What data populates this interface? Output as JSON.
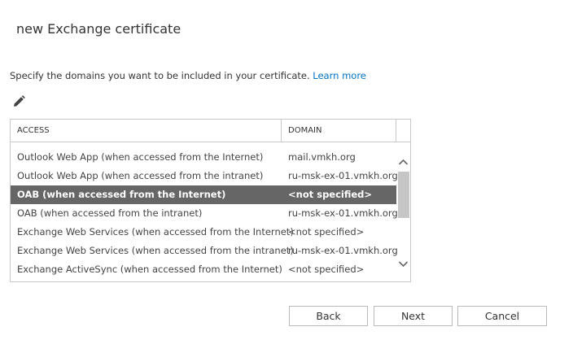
{
  "dialog": {
    "title": "new Exchange certificate",
    "instruction": "Specify the domains you want to be included in your certificate.",
    "learn_more": "Learn more"
  },
  "toolbar": {
    "edit_icon": "pencil-icon"
  },
  "grid": {
    "columns": {
      "access": "ACCESS",
      "domain": "DOMAIN"
    },
    "rows": [
      {
        "access": "Outlook Web App (when accessed from the Internet)",
        "domain": "mail.vmkh.org"
      },
      {
        "access": "Outlook Web App (when accessed from the intranet)",
        "domain": "ru-msk-ex-01.vmkh.org"
      },
      {
        "access": "OAB (when accessed from the Internet)",
        "domain": "<not specified>"
      },
      {
        "access": "OAB (when accessed from the intranet)",
        "domain": "ru-msk-ex-01.vmkh.org"
      },
      {
        "access": "Exchange Web Services (when accessed from the Internet)",
        "domain": "<not specified>"
      },
      {
        "access": "Exchange Web Services (when accessed from the intranet)",
        "domain": "ru-msk-ex-01.vmkh.org"
      },
      {
        "access": "Exchange ActiveSync (when accessed from the Internet)",
        "domain": "<not specified>"
      }
    ],
    "selected_row": 2,
    "scrollbar": {
      "up_icon": "chevron-up-icon",
      "down_icon": "chevron-down-icon"
    }
  },
  "buttons": {
    "back": "Back",
    "next": "Next",
    "cancel": "Cancel"
  },
  "colors": {
    "link": "#0072c6",
    "selected_row_bg": "#666666",
    "border": "#c8c8c8"
  }
}
